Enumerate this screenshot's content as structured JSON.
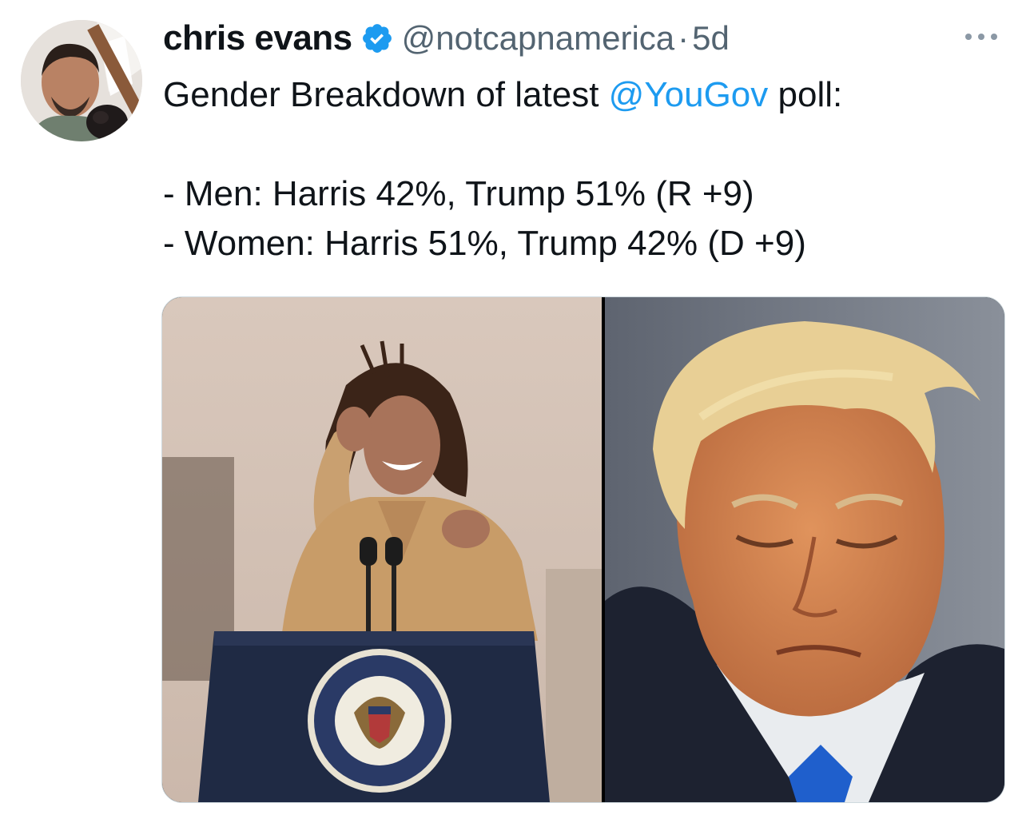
{
  "tweet": {
    "author_name": "chris evans",
    "handle": "@notcapnamerica",
    "separator": "·",
    "time": "5d",
    "text_prefix": "Gender Breakdown of latest ",
    "mention": "@YouGov",
    "text_suffix": " poll:",
    "line_men": "- Men: Harris 42%, Trump 51% (R +9)",
    "line_women": "- Women: Harris 51%, Trump 42% (D +9)"
  },
  "icons": {
    "verified": "verified-badge-icon",
    "more": "more-options-icon"
  },
  "colors": {
    "link": "#1d9bf0",
    "secondary_text": "#536471",
    "verified": "#1d9bf0"
  }
}
